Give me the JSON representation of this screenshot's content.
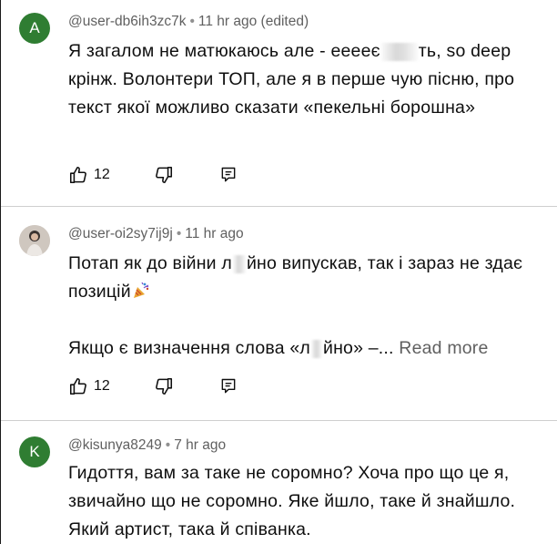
{
  "comments": [
    {
      "avatar_letter": "A",
      "avatar_color": "#2f7d32",
      "handle": "@user-db6ih3zc7k",
      "time": "11 hr ago (edited)",
      "text_a": "Я загалом не матюкаюсь але - ееееє",
      "text_b": "ть, so deep крінж. Волонтери ТОП, але я в перше чую пісню, про текст якої можливо сказати «пекельні борошна»",
      "likes": "12"
    },
    {
      "handle": "@user-oi2sy7ij9j",
      "time": "11 hr ago",
      "text_a": "Потап як до війни л",
      "text_b": "йно випускав, так і зараз не здає позицій",
      "text_c": "Якщо є визначення слова «л",
      "text_d": "йно» –...",
      "read_more": "Read more",
      "likes": "12"
    },
    {
      "avatar_letter": "K",
      "avatar_color": "#2f7d32",
      "handle": "@kisunya8249",
      "time": "7 hr ago",
      "text": "Гидоття, вам за таке не соромно? Хоча про що це я, звичайно що не соромно. Яке йшло, таке й знайшло. Який артист, така й співанка."
    }
  ],
  "separator": "•"
}
